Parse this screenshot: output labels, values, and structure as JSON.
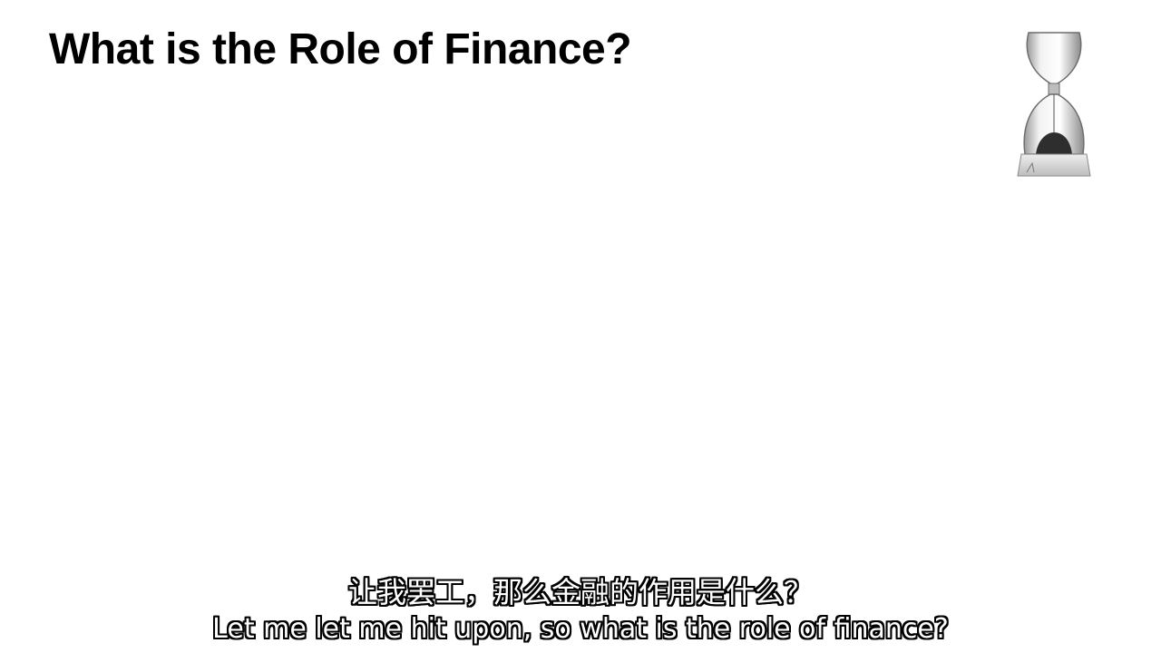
{
  "slide": {
    "title": "What is the Role of Finance?"
  },
  "decoration": {
    "hourglass_icon": "hourglass-icon"
  },
  "subtitles": {
    "chinese": "让我罢工，那么金融的作用是什么？",
    "english": "Let me let me hit upon, so what is the role of finance?"
  }
}
